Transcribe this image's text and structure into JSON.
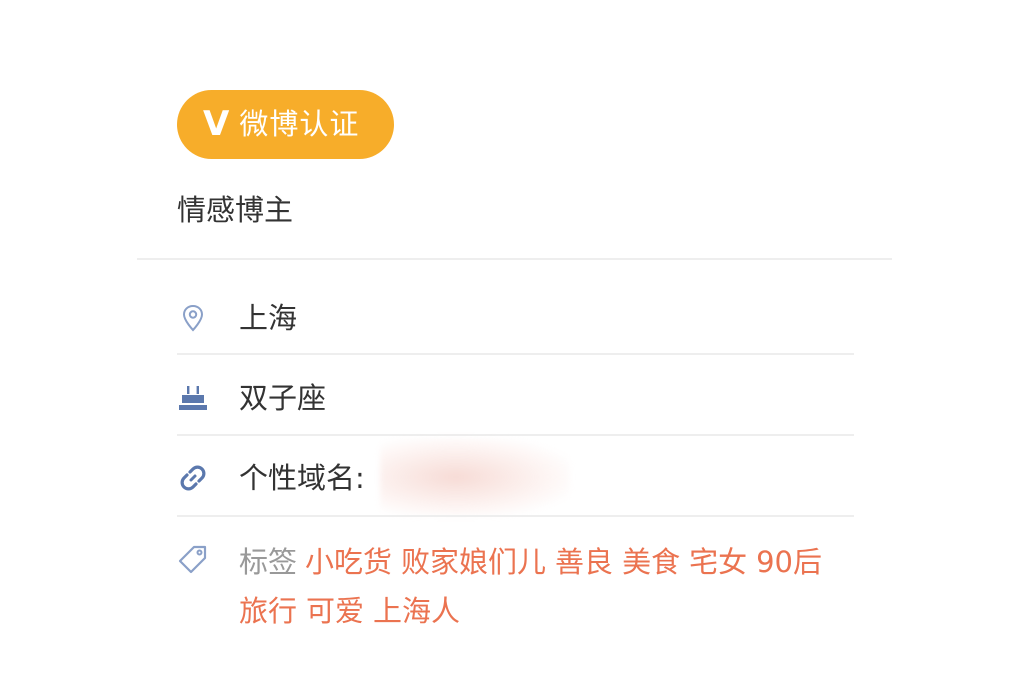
{
  "verification": {
    "badge_icon": "V",
    "badge_label": "微博认证",
    "badge_color": "#f7ad2a",
    "description": "情感博主"
  },
  "info": {
    "location": {
      "icon": "location-pin-icon",
      "value": "上海"
    },
    "birthday": {
      "icon": "birthday-cake-icon",
      "value": "双子座"
    },
    "domain": {
      "icon": "link-icon",
      "label": "个性域名:"
    },
    "tags": {
      "icon": "tag-icon",
      "label": "标签",
      "items": [
        "小吃货",
        "败家娘们儿",
        "善良",
        "美食",
        "宅女",
        "90后",
        "旅行",
        "可爱",
        "上海人"
      ]
    }
  },
  "colors": {
    "tag_text": "#eb7350",
    "icon": "#6e88b5",
    "label_gray": "#999999"
  }
}
